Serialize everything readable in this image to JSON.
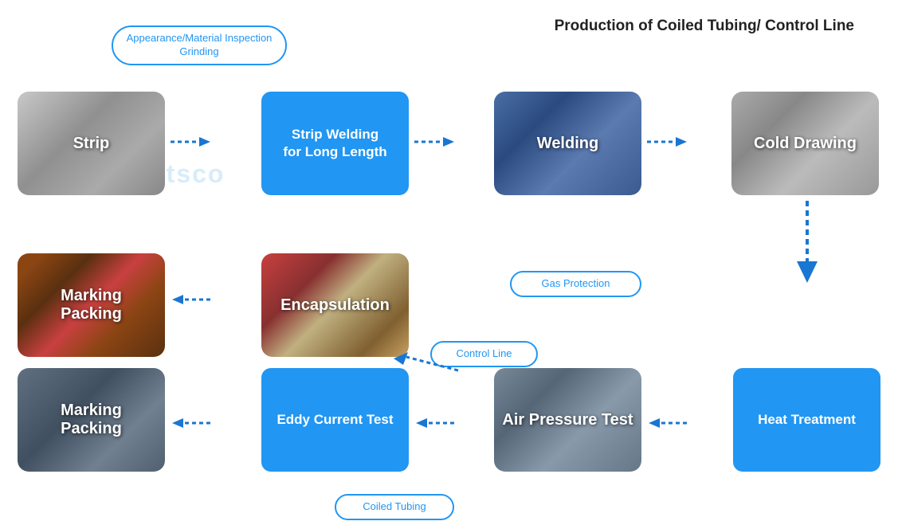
{
  "title": "Production of Coiled Tubing/ Control Line",
  "oval_labels": {
    "appearance": "Appearance/Material Inspection\nGrinding",
    "gas_protection": "Gas Protection",
    "control_line": "Control Line",
    "coiled_tubing": "Coiled Tubing"
  },
  "steps": {
    "strip": "Strip",
    "strip_welding": "Strip Welding\nfor Long Length",
    "welding": "Welding",
    "cold_drawing": "Cold Drawing",
    "marking_packing_top": "Marking\nPacking",
    "encapsulation": "Encapsulation",
    "marking_packing_bottom": "Marking\nPacking",
    "eddy_current": "Eddy Current Test",
    "air_pressure": "Air Pressure Test",
    "heat_treatment": "Heat Treatment"
  },
  "watermark": "Mtsco",
  "colors": {
    "blue": "#2196F3",
    "blue_light": "#64B4E6",
    "arrow_blue": "#1976D2"
  }
}
